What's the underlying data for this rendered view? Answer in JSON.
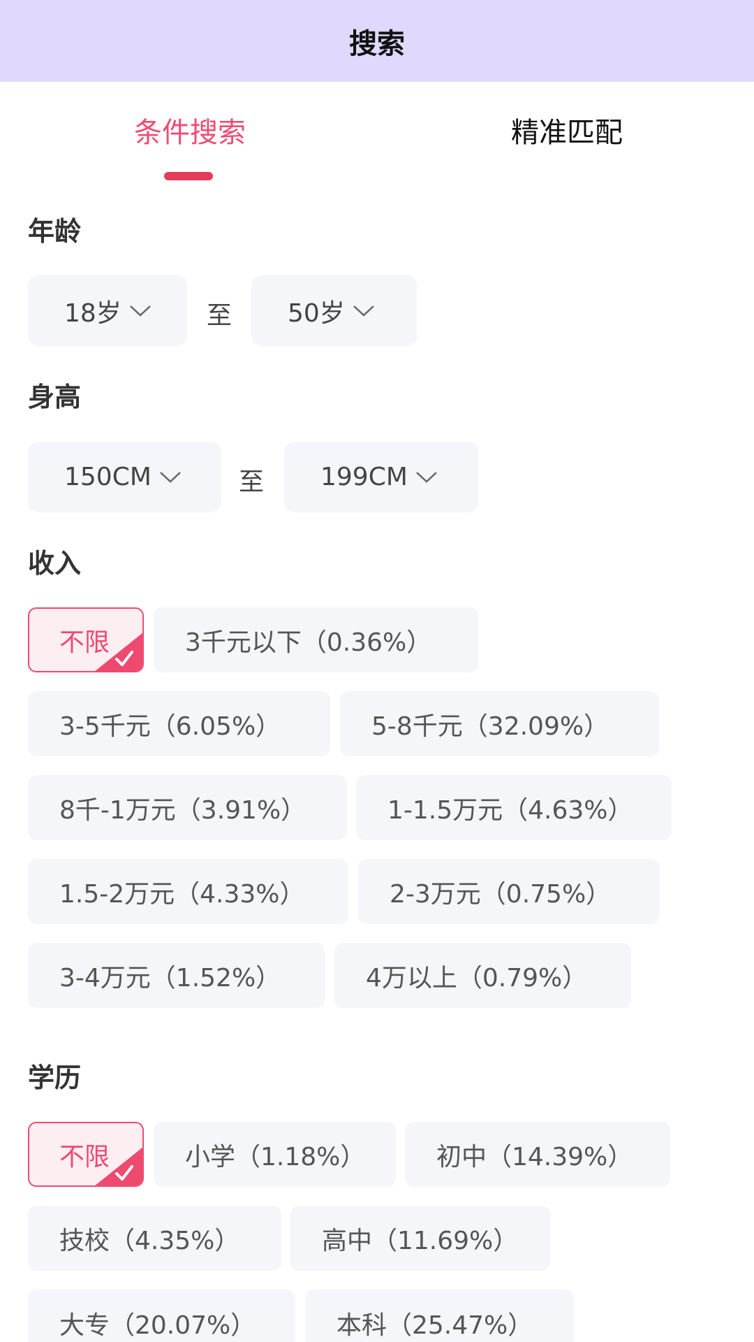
{
  "header": {
    "title": "搜索"
  },
  "tabs": [
    {
      "label": "条件搜索",
      "active": true
    },
    {
      "label": "精准匹配",
      "active": false
    }
  ],
  "age": {
    "label": "年龄",
    "min": "18岁",
    "to": "至",
    "max": "50岁"
  },
  "height": {
    "label": "身高",
    "min": "150CM",
    "to": "至",
    "max": "199CM"
  },
  "income": {
    "label": "收入",
    "options": [
      {
        "label": "不限",
        "selected": true
      },
      {
        "label": "3千元以下（0.36%）",
        "selected": false
      },
      {
        "label": "3-5千元（6.05%）",
        "selected": false
      },
      {
        "label": "5-8千元（32.09%）",
        "selected": false
      },
      {
        "label": "8千-1万元（3.91%）",
        "selected": false
      },
      {
        "label": "1-1.5万元（4.63%）",
        "selected": false
      },
      {
        "label": "1.5-2万元（4.33%）",
        "selected": false
      },
      {
        "label": "2-3万元（0.75%）",
        "selected": false
      },
      {
        "label": "3-4万元（1.52%）",
        "selected": false
      },
      {
        "label": "4万以上（0.79%）",
        "selected": false
      }
    ]
  },
  "education": {
    "label": "学历",
    "options": [
      {
        "label": "不限",
        "selected": true
      },
      {
        "label": "小学（1.18%）",
        "selected": false
      },
      {
        "label": "初中（14.39%）",
        "selected": false
      },
      {
        "label": "技校（4.35%）",
        "selected": false
      },
      {
        "label": "高中（11.69%）",
        "selected": false
      },
      {
        "label": "大专（20.07%）",
        "selected": false
      },
      {
        "label": "本科（25.47%）",
        "selected": false
      }
    ]
  },
  "colors": {
    "accent": "#ef4b73",
    "header_bg": "#e1d9fd",
    "chip_bg": "#f5f6fa"
  }
}
